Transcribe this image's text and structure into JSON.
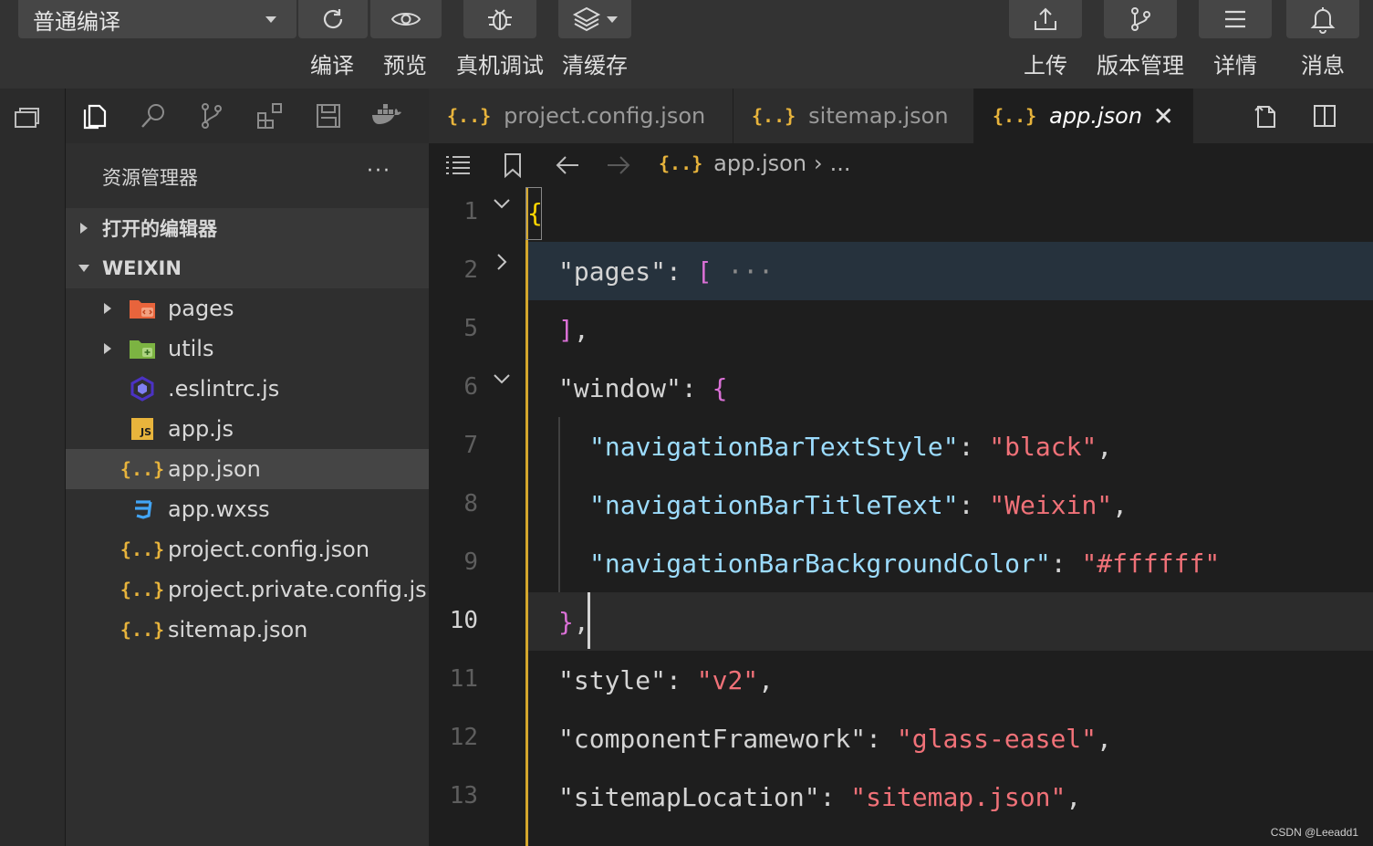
{
  "toolbar": {
    "mode_select": "普通编译",
    "buttons": [
      {
        "label": "编译",
        "icon": "refresh-icon"
      },
      {
        "label": "预览",
        "icon": "eye-icon"
      },
      {
        "label": "真机调试",
        "icon": "bug-icon"
      },
      {
        "label": "清缓存",
        "icon": "layers-icon"
      },
      {
        "label": "上传",
        "icon": "upload-icon"
      },
      {
        "label": "版本管理",
        "icon": "branch-icon"
      },
      {
        "label": "详情",
        "icon": "menu-icon"
      },
      {
        "label": "消息",
        "icon": "bell-icon"
      }
    ]
  },
  "sidebar": {
    "title": "资源管理器",
    "more": "···",
    "sections": {
      "open_editors": "打开的编辑器",
      "project": "WEIXIN"
    },
    "files": [
      {
        "name": "pages",
        "type": "folder",
        "icon": "pages-folder-icon"
      },
      {
        "name": "utils",
        "type": "folder",
        "icon": "utils-folder-icon"
      },
      {
        "name": ".eslintrc.js",
        "type": "file",
        "icon": "eslint-icon"
      },
      {
        "name": "app.js",
        "type": "file",
        "icon": "js-icon",
        "icon_text": "JS"
      },
      {
        "name": "app.json",
        "type": "file",
        "icon": "json-icon",
        "selected": true
      },
      {
        "name": "app.wxss",
        "type": "file",
        "icon": "css-icon"
      },
      {
        "name": "project.config.json",
        "type": "file",
        "icon": "json-icon"
      },
      {
        "name": "project.private.config.js...",
        "type": "file",
        "icon": "json-icon"
      },
      {
        "name": "sitemap.json",
        "type": "file",
        "icon": "json-icon"
      }
    ]
  },
  "json_glyph": "{..}",
  "tabs": [
    {
      "label": "project.config.json",
      "active": false
    },
    {
      "label": "sitemap.json",
      "active": false
    },
    {
      "label": "app.json",
      "active": true,
      "close": "✕"
    }
  ],
  "breadcrumb": {
    "file": "app.json",
    "sep": "›",
    "rest": "..."
  },
  "editor": {
    "lines": [
      {
        "n": "1",
        "text": "{"
      },
      {
        "n": "2",
        "text": "\"pages\": [ ···"
      },
      {
        "n": "5",
        "text": "],"
      },
      {
        "n": "6",
        "text": "\"window\": {"
      },
      {
        "n": "7",
        "text": "\"navigationBarTextStyle\": \"black\","
      },
      {
        "n": "8",
        "text": "\"navigationBarTitleText\": \"Weixin\","
      },
      {
        "n": "9",
        "text": "\"navigationBarBackgroundColor\": \"#ffffff\""
      },
      {
        "n": "10",
        "text": "},"
      },
      {
        "n": "11",
        "text": "\"style\": \"v2\","
      },
      {
        "n": "12",
        "text": "\"componentFramework\": \"glass-easel\","
      },
      {
        "n": "13",
        "text": "\"sitemapLocation\": \"sitemap.json\","
      }
    ],
    "tokens": {
      "pages_key": "\"pages\"",
      "window_key": "\"window\"",
      "nbts_key": "\"navigationBarTextStyle\"",
      "nbts_val": "\"black\"",
      "nbtt_key": "\"navigationBarTitleText\"",
      "nbtt_val": "\"Weixin\"",
      "nbbc_key": "\"navigationBarBackgroundColor\"",
      "nbbc_val": "\"#ffffff\"",
      "style_key": "\"style\"",
      "style_val": "\"v2\"",
      "cf_key": "\"componentFramework\"",
      "cf_val": "\"glass-easel\"",
      "sl_key": "\"sitemapLocation\"",
      "sl_val": "\"sitemap.json\"",
      "ellipsis": "···"
    }
  },
  "watermark": "CSDN @Leeadd1",
  "colors": {
    "json_icon": "#e8b43c",
    "key": "#9cdcfe",
    "string": "#ce9178",
    "bracket_gold": "#ffd700",
    "bracket_pink": "#da70d6"
  }
}
